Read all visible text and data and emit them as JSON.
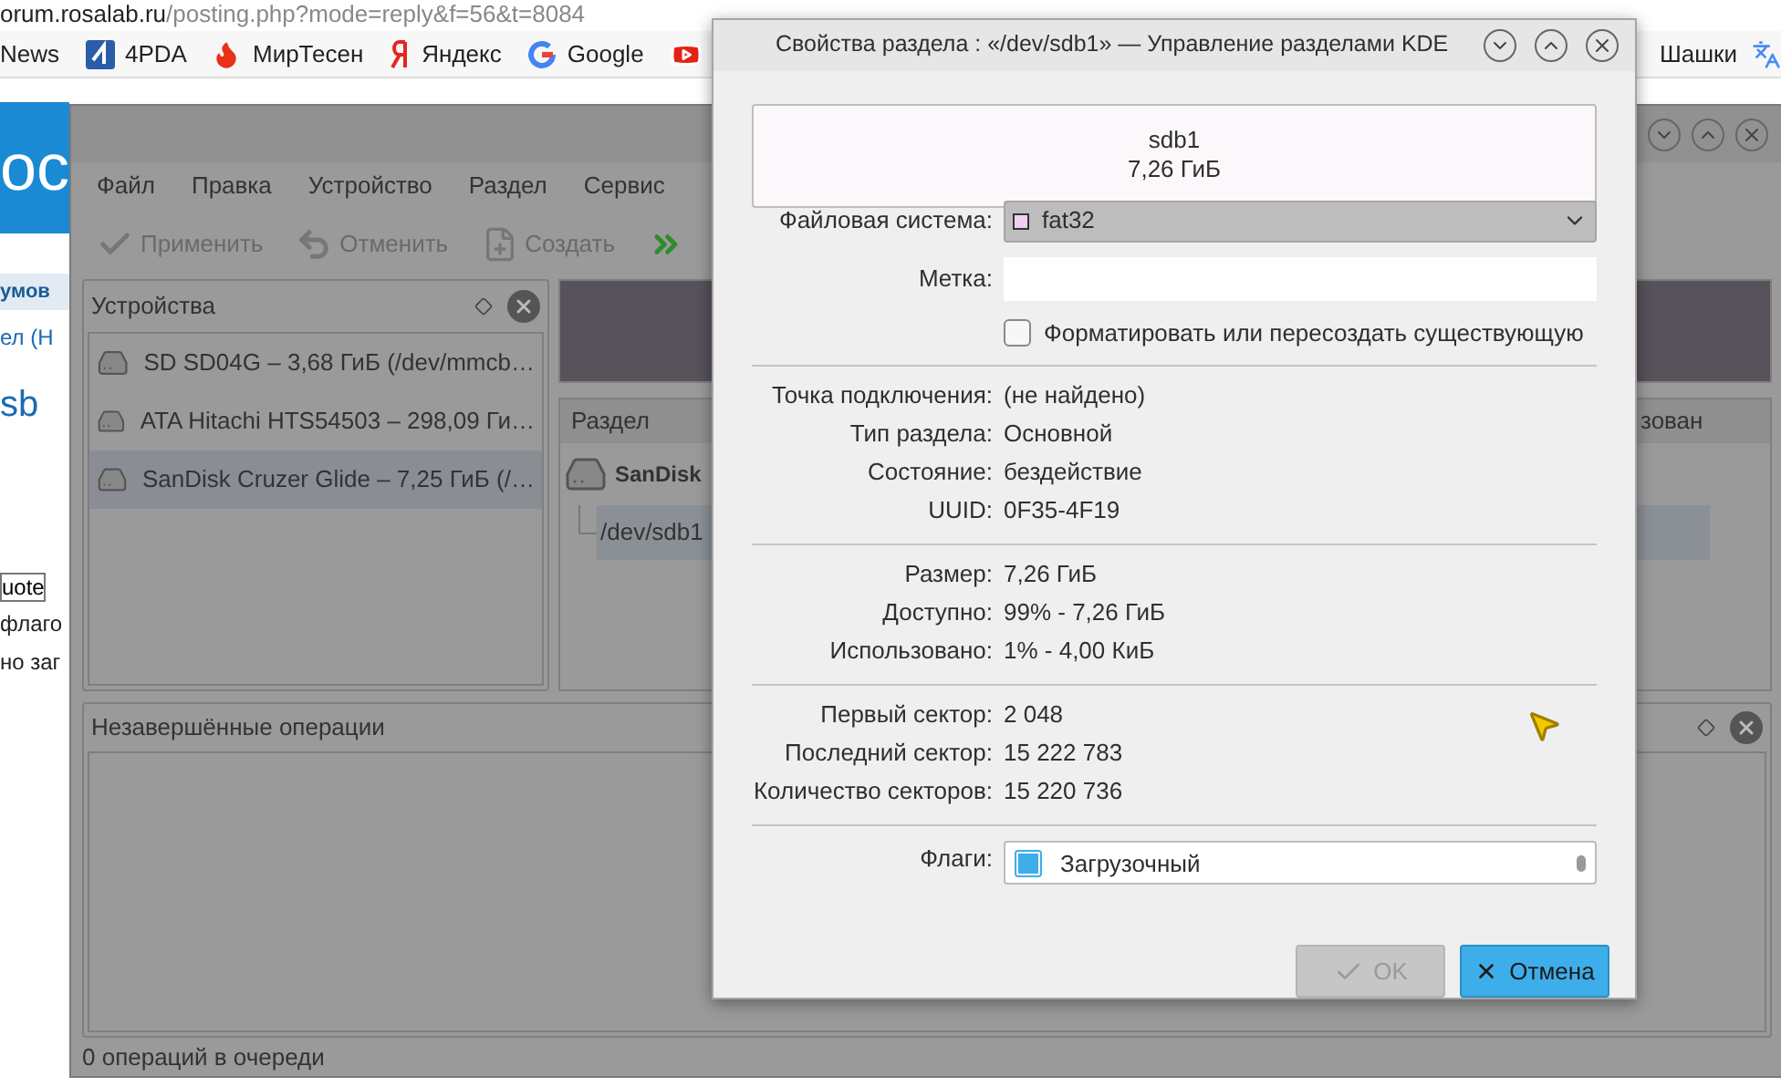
{
  "browser": {
    "url_domain": "orum.rosalab.ru",
    "url_path": "/posting.php?mode=reply&f=56&t=8084",
    "bookmarks": [
      {
        "label": "News",
        "kind": "none"
      },
      {
        "label": "4PDA",
        "kind": "pda"
      },
      {
        "label": "МирТесен",
        "kind": "flame"
      },
      {
        "label": "Яндекс",
        "kind": "ya"
      },
      {
        "label": "Google",
        "kind": "google"
      },
      {
        "kind": "video"
      }
    ],
    "bookmarks_right": [
      {
        "label": "Шашки",
        "kind": "none"
      },
      {
        "kind": "translate"
      }
    ],
    "page": {
      "logo": "oc",
      "forum_link": "умов",
      "breadcrumb": "ел (Н",
      "heading": "sb",
      "quote_button": "uote",
      "lines": [
        "флаго",
        "но заг"
      ]
    }
  },
  "manager": {
    "menu": [
      "Файл",
      "Правка",
      "Устройство",
      "Раздел",
      "Сервис"
    ],
    "toolbar": [
      {
        "label": "Применить",
        "kind": "apply"
      },
      {
        "label": "Отменить",
        "kind": "undo"
      },
      {
        "label": "Создать",
        "kind": "new"
      },
      {
        "kind": "run"
      }
    ],
    "devices": {
      "title": "Устройства",
      "items": [
        {
          "label": "SD SD04G – 3,68 ГиБ (/dev/mmcb…",
          "selected": false
        },
        {
          "label": "ATA Hitachi HTS54503 – 298,09 Ги…",
          "selected": false
        },
        {
          "label": "SanDisk Cruzer Glide – 7,25 ГиБ (/…",
          "selected": true
        }
      ]
    },
    "partitions": {
      "columns": [
        "Раздел",
        "зован"
      ],
      "device": "SanDisk",
      "rows": [
        {
          "label": "/dev/sdb1",
          "selected": true
        }
      ]
    },
    "pending": {
      "title": "Незавершённые операции"
    },
    "status": "0 операций в очереди"
  },
  "dialog": {
    "title": "Свойства раздела : «/dev/sdb1» — Управление разделами KDE",
    "partition": {
      "name": "sdb1",
      "size": "7,26 ГиБ"
    },
    "filesystem": {
      "label": "Файловая система:",
      "value": "fat32",
      "color": "#f0d0f0"
    },
    "label_field": {
      "label": "Метка:"
    },
    "format": {
      "label": "Форматировать или пересоздать существующую",
      "checked": false
    },
    "groups": [
      [
        {
          "label": "Точка подключения:",
          "value": "(не найдено)"
        },
        {
          "label": "Тип раздела:",
          "value": "Основной"
        },
        {
          "label": "Состояние:",
          "value": "бездействие"
        },
        {
          "label": "UUID:",
          "value": "0F35-4F19"
        }
      ],
      [
        {
          "label": "Размер:",
          "value": "7,26 ГиБ"
        },
        {
          "label": "Доступно:",
          "value": "99% - 7,26 ГиБ"
        },
        {
          "label": "Использовано:",
          "value": "1% - 4,00 КиБ"
        }
      ],
      [
        {
          "label": "Первый сектор:",
          "value": "2 048"
        },
        {
          "label": "Последний сектор:",
          "value": "15 222 783"
        },
        {
          "label": "Количество секторов:",
          "value": "15 220 736"
        }
      ]
    ],
    "flags": {
      "label": "Флаги:",
      "items": [
        {
          "label": "Загрузочный",
          "checked": true
        }
      ]
    },
    "buttons": [
      {
        "label": "OK",
        "kind": "ok",
        "disabled": true
      },
      {
        "label": "Отмена",
        "kind": "cancel",
        "disabled": false
      }
    ]
  }
}
